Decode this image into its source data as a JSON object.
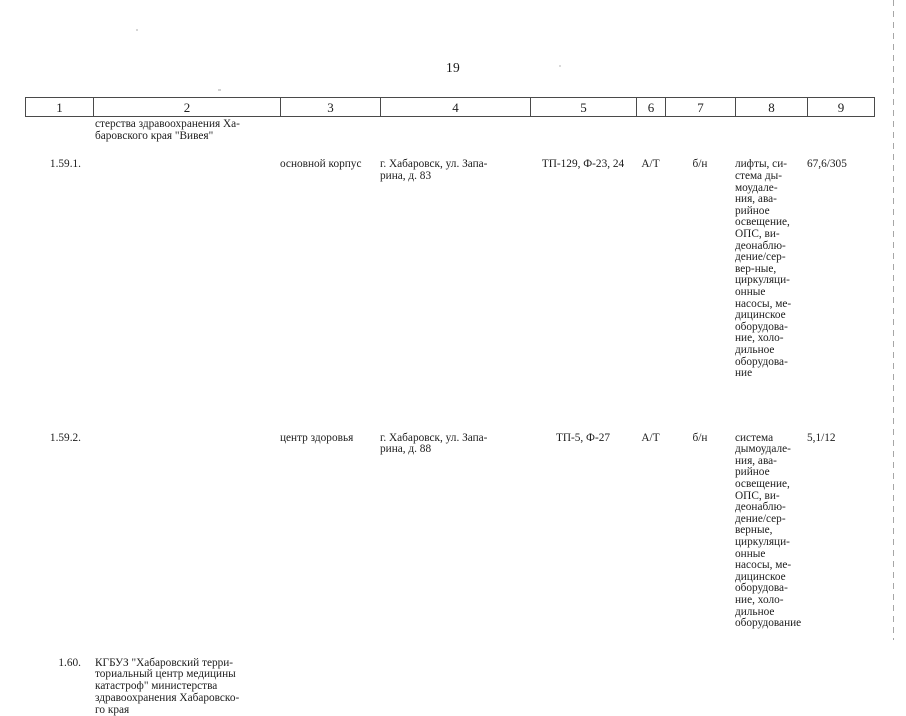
{
  "page": {
    "number": "19"
  },
  "table": {
    "column_numbers": [
      "1",
      "2",
      "3",
      "4",
      "5",
      "6",
      "7",
      "8",
      "9"
    ],
    "continuation": {
      "col2_lines": [
        "стерства здравоохранения Ха-",
        "баровского края \"Вивея\""
      ]
    },
    "rows": [
      {
        "col1": "1.59.1.",
        "col2_lines": [],
        "col3_lines": [
          "основной корпус"
        ],
        "col4_lines": [
          "г. Хабаровск, ул. Запа-",
          "рина, д. 83"
        ],
        "col5_lines": [
          "ТП-129, Ф-23, 24"
        ],
        "col6_lines": [
          "А/Т"
        ],
        "col7_lines": [
          "б/н"
        ],
        "col8_lines": [
          "лифты, си-",
          "стема ды-",
          "моудале-",
          "ния, ава-",
          "рийное",
          "освещение,",
          "ОПС, ви-",
          "деонаблю-",
          "дение/сер-",
          "вер-ные,",
          "циркуляци-",
          "онные",
          "насосы, ме-",
          "дицинское",
          "оборудова-",
          "ние, холо-",
          "дильное",
          "оборудова-",
          "ние"
        ],
        "col9_lines": [
          "67,6/305"
        ]
      },
      {
        "col1": "1.59.2.",
        "col2_lines": [],
        "col3_lines": [
          "центр здоровья"
        ],
        "col4_lines": [
          "г. Хабаровск, ул. Запа-",
          "рина, д. 88"
        ],
        "col5_lines": [
          "ТП-5, Ф-27"
        ],
        "col6_lines": [
          "А/Т"
        ],
        "col7_lines": [
          "б/н"
        ],
        "col8_lines": [
          "система",
          "дымоудале-",
          "ния, ава-",
          "рийное",
          "освещение,",
          "ОПС, ви-",
          "деонаблю-",
          "дение/сер-",
          "верные,",
          "циркуляци-",
          "онные",
          "насосы, ме-",
          "дицинское",
          "оборудова-",
          "ние, холо-",
          "дильное",
          "оборудование"
        ],
        "col9_lines": [
          "5,1/12"
        ]
      },
      {
        "col1": "1.60.",
        "col2_lines": [
          "КГБУЗ \"Хабаровский терри-",
          "ториальный центр медицины",
          "катастроф\" министерства",
          "здравоохранения Хабаровско-",
          "го края"
        ],
        "col3_lines": [],
        "col4_lines": [],
        "col5_lines": [],
        "col6_lines": [],
        "col7_lines": [],
        "col8_lines": [],
        "col9_lines": []
      }
    ]
  }
}
